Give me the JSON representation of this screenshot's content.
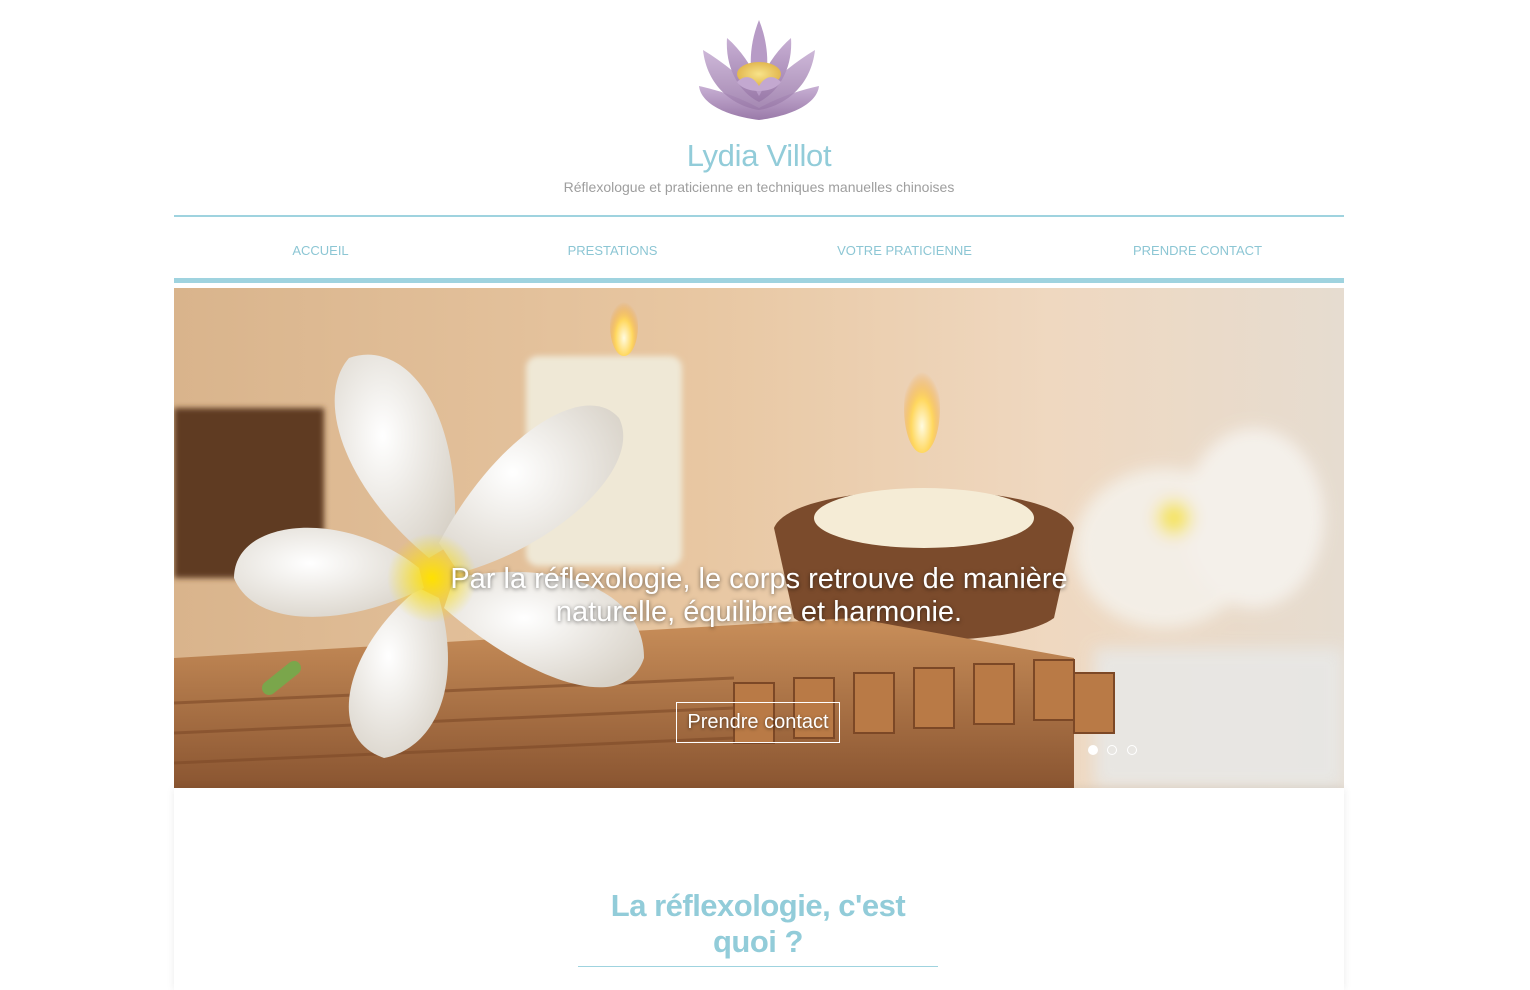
{
  "header": {
    "logo_icon": "lotus-flower-icon",
    "title": "Lydia Villot",
    "tagline": "Réflexologue et praticienne en techniques manuelles chinoises"
  },
  "nav": {
    "items": [
      {
        "label": "ACCUEIL"
      },
      {
        "label": "PRESTATIONS"
      },
      {
        "label": "VOTRE PRATICIENNE"
      },
      {
        "label": "PRENDRE CONTACT"
      }
    ]
  },
  "slider": {
    "caption_line1": "Par la réflexologie, le corps retrouve de manière",
    "caption_line2": "naturelle, équilibre et harmonie.",
    "button_label": "Prendre contact",
    "slide_count": 3,
    "active_slide": 1
  },
  "content": {
    "section_title": "La réflexologie, c'est quoi ?"
  },
  "colors": {
    "accent": "#92ccd9",
    "nav_text": "#8cc6d4",
    "tagline": "#9e9e9e"
  }
}
